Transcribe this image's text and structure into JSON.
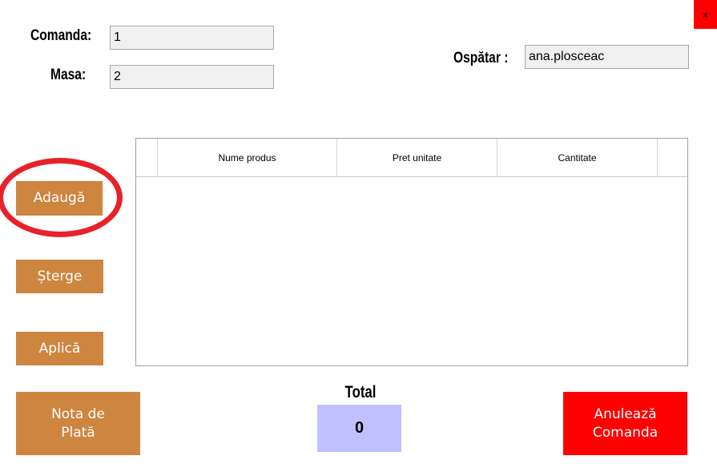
{
  "close_button": {
    "label": "x"
  },
  "order": {
    "comanda_label": "Comanda:",
    "comanda_value": "1",
    "masa_label": "Masa:",
    "masa_value": "2",
    "ospatar_label": "Ospătar :",
    "ospatar_value": "ana.plosceac"
  },
  "grid": {
    "columns": [
      "Nume produs",
      "Pret unitate",
      "Cantitate"
    ],
    "rows": []
  },
  "buttons": {
    "adauga": "Adaugă",
    "sterge": "Șterge",
    "aplica": "Aplică",
    "nota_line1": "Nota de",
    "nota_line2": "Plată",
    "anuleaza_line1": "Anulează",
    "anuleaza_line2": "Comanda"
  },
  "total": {
    "label": "Total",
    "value": "0"
  },
  "colors": {
    "action_button": "#cd853f",
    "cancel_button": "#ff0000",
    "total_box": "#c0c0ff",
    "highlight_circle": "#e8212a"
  }
}
